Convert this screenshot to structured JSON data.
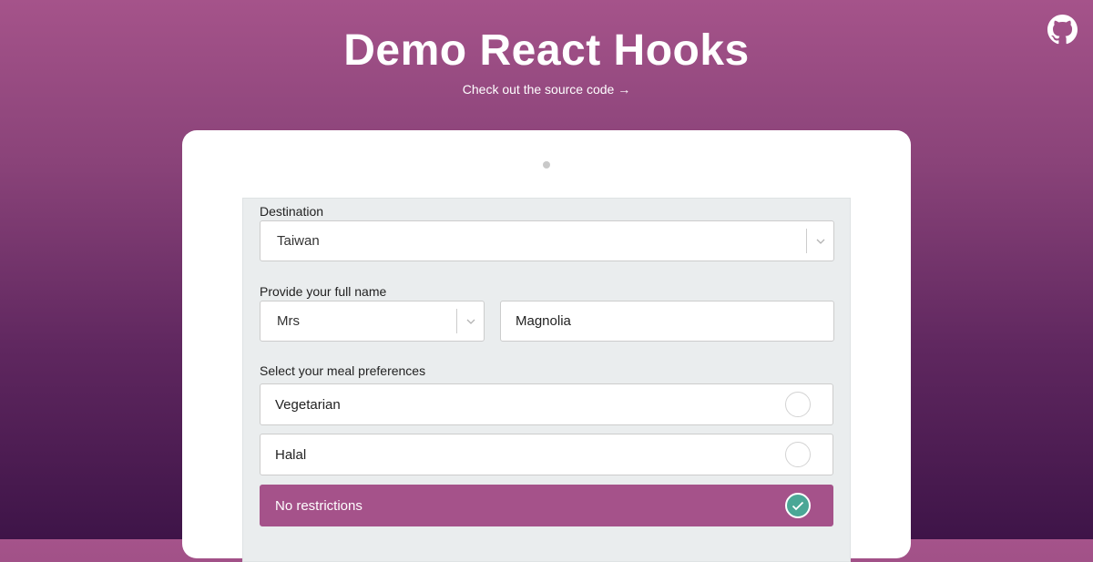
{
  "header": {
    "title": "Demo React Hooks",
    "source_link": "Check out the source code →"
  },
  "form": {
    "destination": {
      "label": "Destination",
      "value": "Taiwan"
    },
    "full_name": {
      "label": "Provide your full name",
      "title_value": "Mrs",
      "name_value": "Magnolia"
    },
    "meal": {
      "label": "Select your meal preferences",
      "options": [
        {
          "label": "Vegetarian",
          "selected": false
        },
        {
          "label": "Halal",
          "selected": false
        },
        {
          "label": "No restrictions",
          "selected": true
        }
      ]
    }
  },
  "colors": {
    "accent": "#a5528a",
    "check": "#4aa796"
  },
  "icons": {
    "github": "github-icon",
    "chevron": "chevron-down-icon",
    "check": "check-icon"
  }
}
